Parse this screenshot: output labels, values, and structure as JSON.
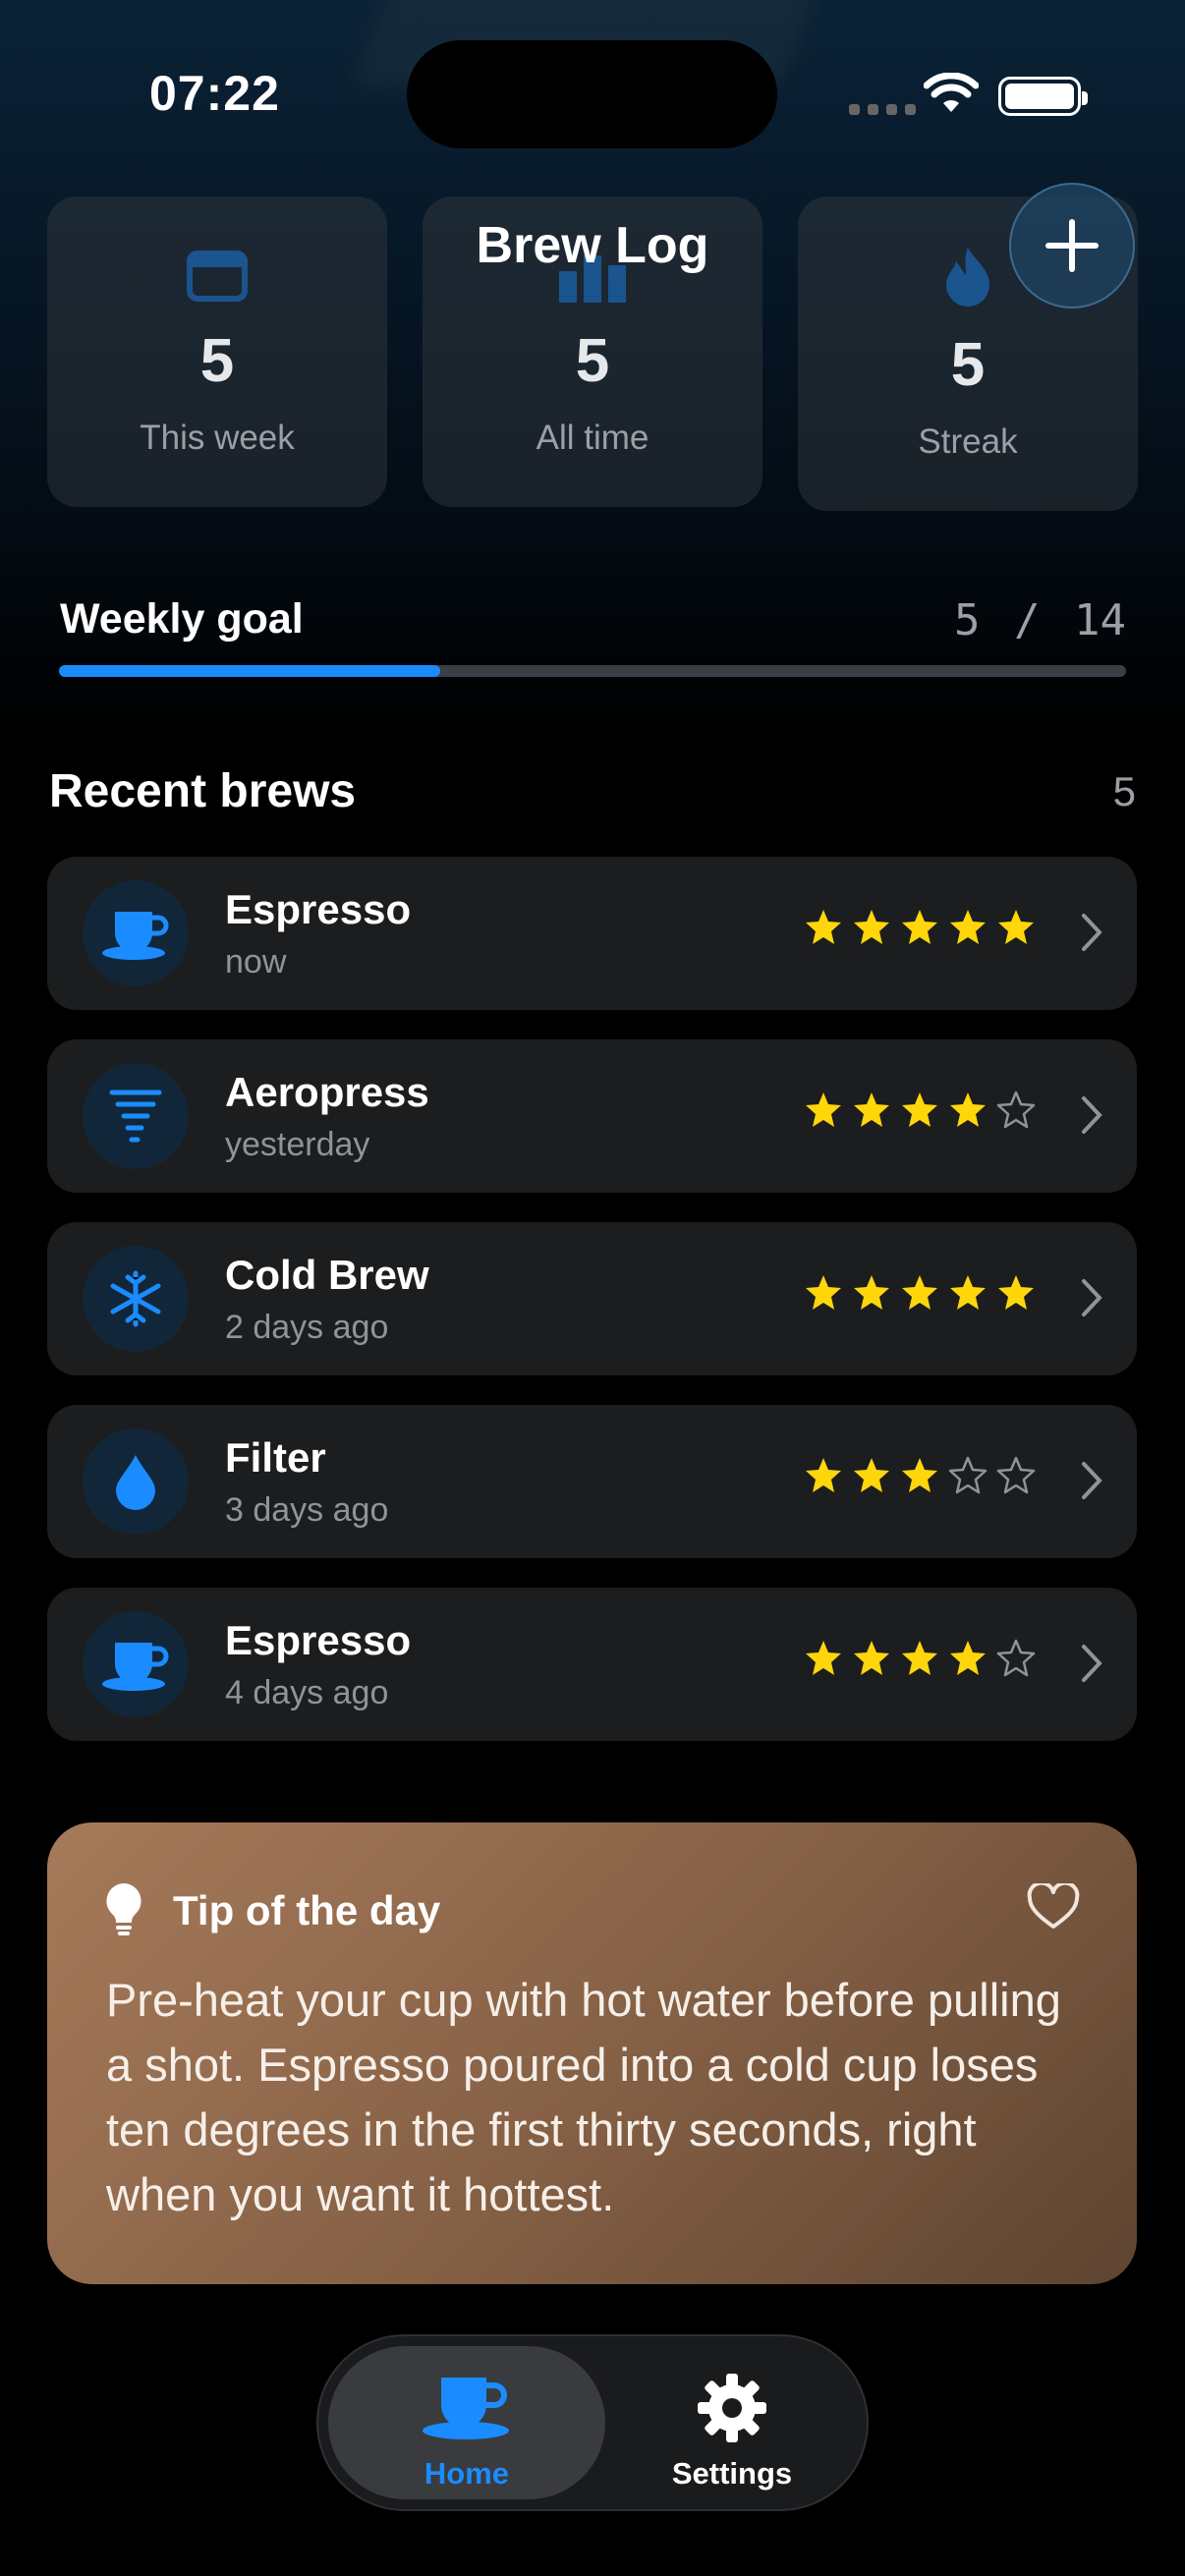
{
  "status_bar": {
    "time": "07:22"
  },
  "header": {
    "title": "Brew Log",
    "add_icon": "plus-icon"
  },
  "stats": [
    {
      "value": "5",
      "label": "This week",
      "icon": "calendar-icon"
    },
    {
      "value": "5",
      "label": "All time",
      "icon": "bar-chart-icon"
    },
    {
      "value": "5",
      "label": "Streak",
      "icon": "flame-icon"
    }
  ],
  "weekly_goal": {
    "label": "Weekly goal",
    "current": 5,
    "target": 14,
    "count_text": "5 / 14"
  },
  "recent": {
    "title": "Recent brews",
    "count": "5",
    "items": [
      {
        "name": "Espresso",
        "when": "now",
        "rating": 5,
        "icon": "coffee-cup-icon"
      },
      {
        "name": "Aeropress",
        "when": "yesterday",
        "rating": 4,
        "icon": "tornado-icon"
      },
      {
        "name": "Cold Brew",
        "when": "2 days ago",
        "rating": 5,
        "icon": "snowflake-icon"
      },
      {
        "name": "Filter",
        "when": "3 days ago",
        "rating": 3,
        "icon": "drop-icon"
      },
      {
        "name": "Espresso",
        "when": "4 days ago",
        "rating": 4,
        "icon": "coffee-cup-icon"
      }
    ]
  },
  "tip": {
    "title": "Tip of the day",
    "text": "Pre-heat your cup with hot water before pulling a shot. Espresso poured into a cold cup loses ten degrees in the first thirty seconds, right when you want it hottest."
  },
  "tabs": [
    {
      "label": "Home",
      "icon": "coffee-cup-icon",
      "active": true
    },
    {
      "label": "Settings",
      "icon": "gear-icon",
      "active": false
    }
  ],
  "colors": {
    "accent": "#1a8cff",
    "star": "#ffd60a",
    "card": "#1c1d1f"
  }
}
